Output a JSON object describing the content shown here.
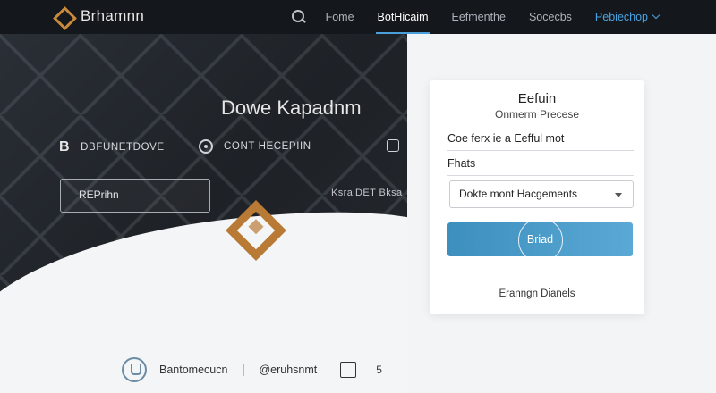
{
  "header": {
    "brand": "Brhamnn",
    "nav": [
      {
        "label": "Fome"
      },
      {
        "label": "BotHicaim",
        "active": true
      },
      {
        "label": "Eefmenthe"
      },
      {
        "label": "Socecbs"
      },
      {
        "label": "Pebiechop",
        "accent": true,
        "dropdown": true
      }
    ]
  },
  "hero": {
    "title": "Dowe Kapadnm",
    "features": [
      {
        "icon": "b-icon",
        "label": "DBFUNETDOVE"
      },
      {
        "icon": "circle-icon",
        "label": "CONT HECEPIIN"
      },
      {
        "icon": "square-icon",
        "label": ""
      }
    ],
    "button_label": "REPrihn",
    "caption": "KsraiDET Bksa"
  },
  "form": {
    "title": "Eefuin",
    "subtitle": "Onmerm Precese",
    "field1_value": "Coe ferx ie a Eefful mot",
    "field2_value": "Fhats",
    "select_value": "Dokte mont Hacgements",
    "submit_label": "Briad",
    "link_text": "Eranngn Dianels"
  },
  "footer": {
    "brand": "Bantomecucn",
    "social": "@eruhsnmt",
    "extra": "5"
  },
  "colors": {
    "topbar": "#14171c",
    "accent": "#4a9fd8",
    "brand_orange": "#c98a3a",
    "button_blue": "#3d8fbd"
  }
}
